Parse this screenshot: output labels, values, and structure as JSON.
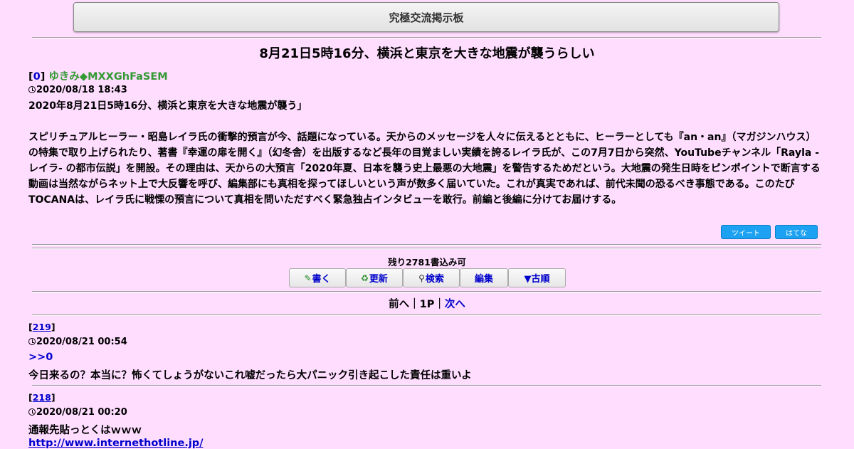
{
  "board": {
    "title": "究極交流掲示板"
  },
  "thread": {
    "title": "8月21日5時16分、横浜と東京を大きな地震が襲うらしい"
  },
  "first_post": {
    "number": "0",
    "name": "ゆきみ◆MXXGhFaSEM",
    "date": "2020/08/18 18:43",
    "body_line1": "2020年8月21日5時16分、横浜と東京を大きな地震が襲う」",
    "body_para": "スピリチュアルヒーラー・昭島レイラ氏の衝撃的預言が今、話題になっている。天からのメッセージを人々に伝えるとともに、ヒーラーとしても『an・an』（マガジンハウス）の特集で取り上げられたり、著書『幸運の扉を開く』（幻冬舎）を出版するなど長年の目覚ましい実績を誇るレイラ氏が、この7月7日から突然、YouTubeチャンネル「Rayla -レイラ- の都市伝説」を開設。その理由は、天からの大預言「2020年夏、日本を襲う史上最悪の大地震」を警告するためだという。大地震の発生日時をピンポイントで断言する動画は当然ながらネット上で大反響を呼び、編集部にも真相を探ってほしいという声が数多く届いていた。これが真実であれば、前代未聞の恐るべき事態である。このたびTOCANAは、レイラ氏に戦慄の預言について真相を問いただすべく緊急独占インタビューを敢行。前編と後編に分けてお届けする。"
  },
  "share": {
    "tweet": "ツイート",
    "hatena": "はてな"
  },
  "remaining": "残り2781書込み可",
  "toolbar": {
    "write": "書く",
    "write_icon": "pencil-icon",
    "update": "更新",
    "update_icon": "refresh-icon",
    "search": "検索",
    "search_icon": "search-icon",
    "edit": "編集",
    "old_order": "▼古順"
  },
  "pager": {
    "prev": "前へ",
    "sep1": "｜",
    "page": "1P",
    "sep2": "｜",
    "next": "次へ"
  },
  "replies": [
    {
      "number": "219",
      "date": "2020/08/21 00:54",
      "anchor": ">>0",
      "text": "今日来るの？本当に？怖くてしょうがないこれ嘘だったら大パニック引き起こした責任は重いよ"
    },
    {
      "number": "218",
      "date": "2020/08/21 00:20",
      "text": "通報先貼っとくはｗｗｗ",
      "url": "http://www.internethotline.jp/"
    }
  ]
}
